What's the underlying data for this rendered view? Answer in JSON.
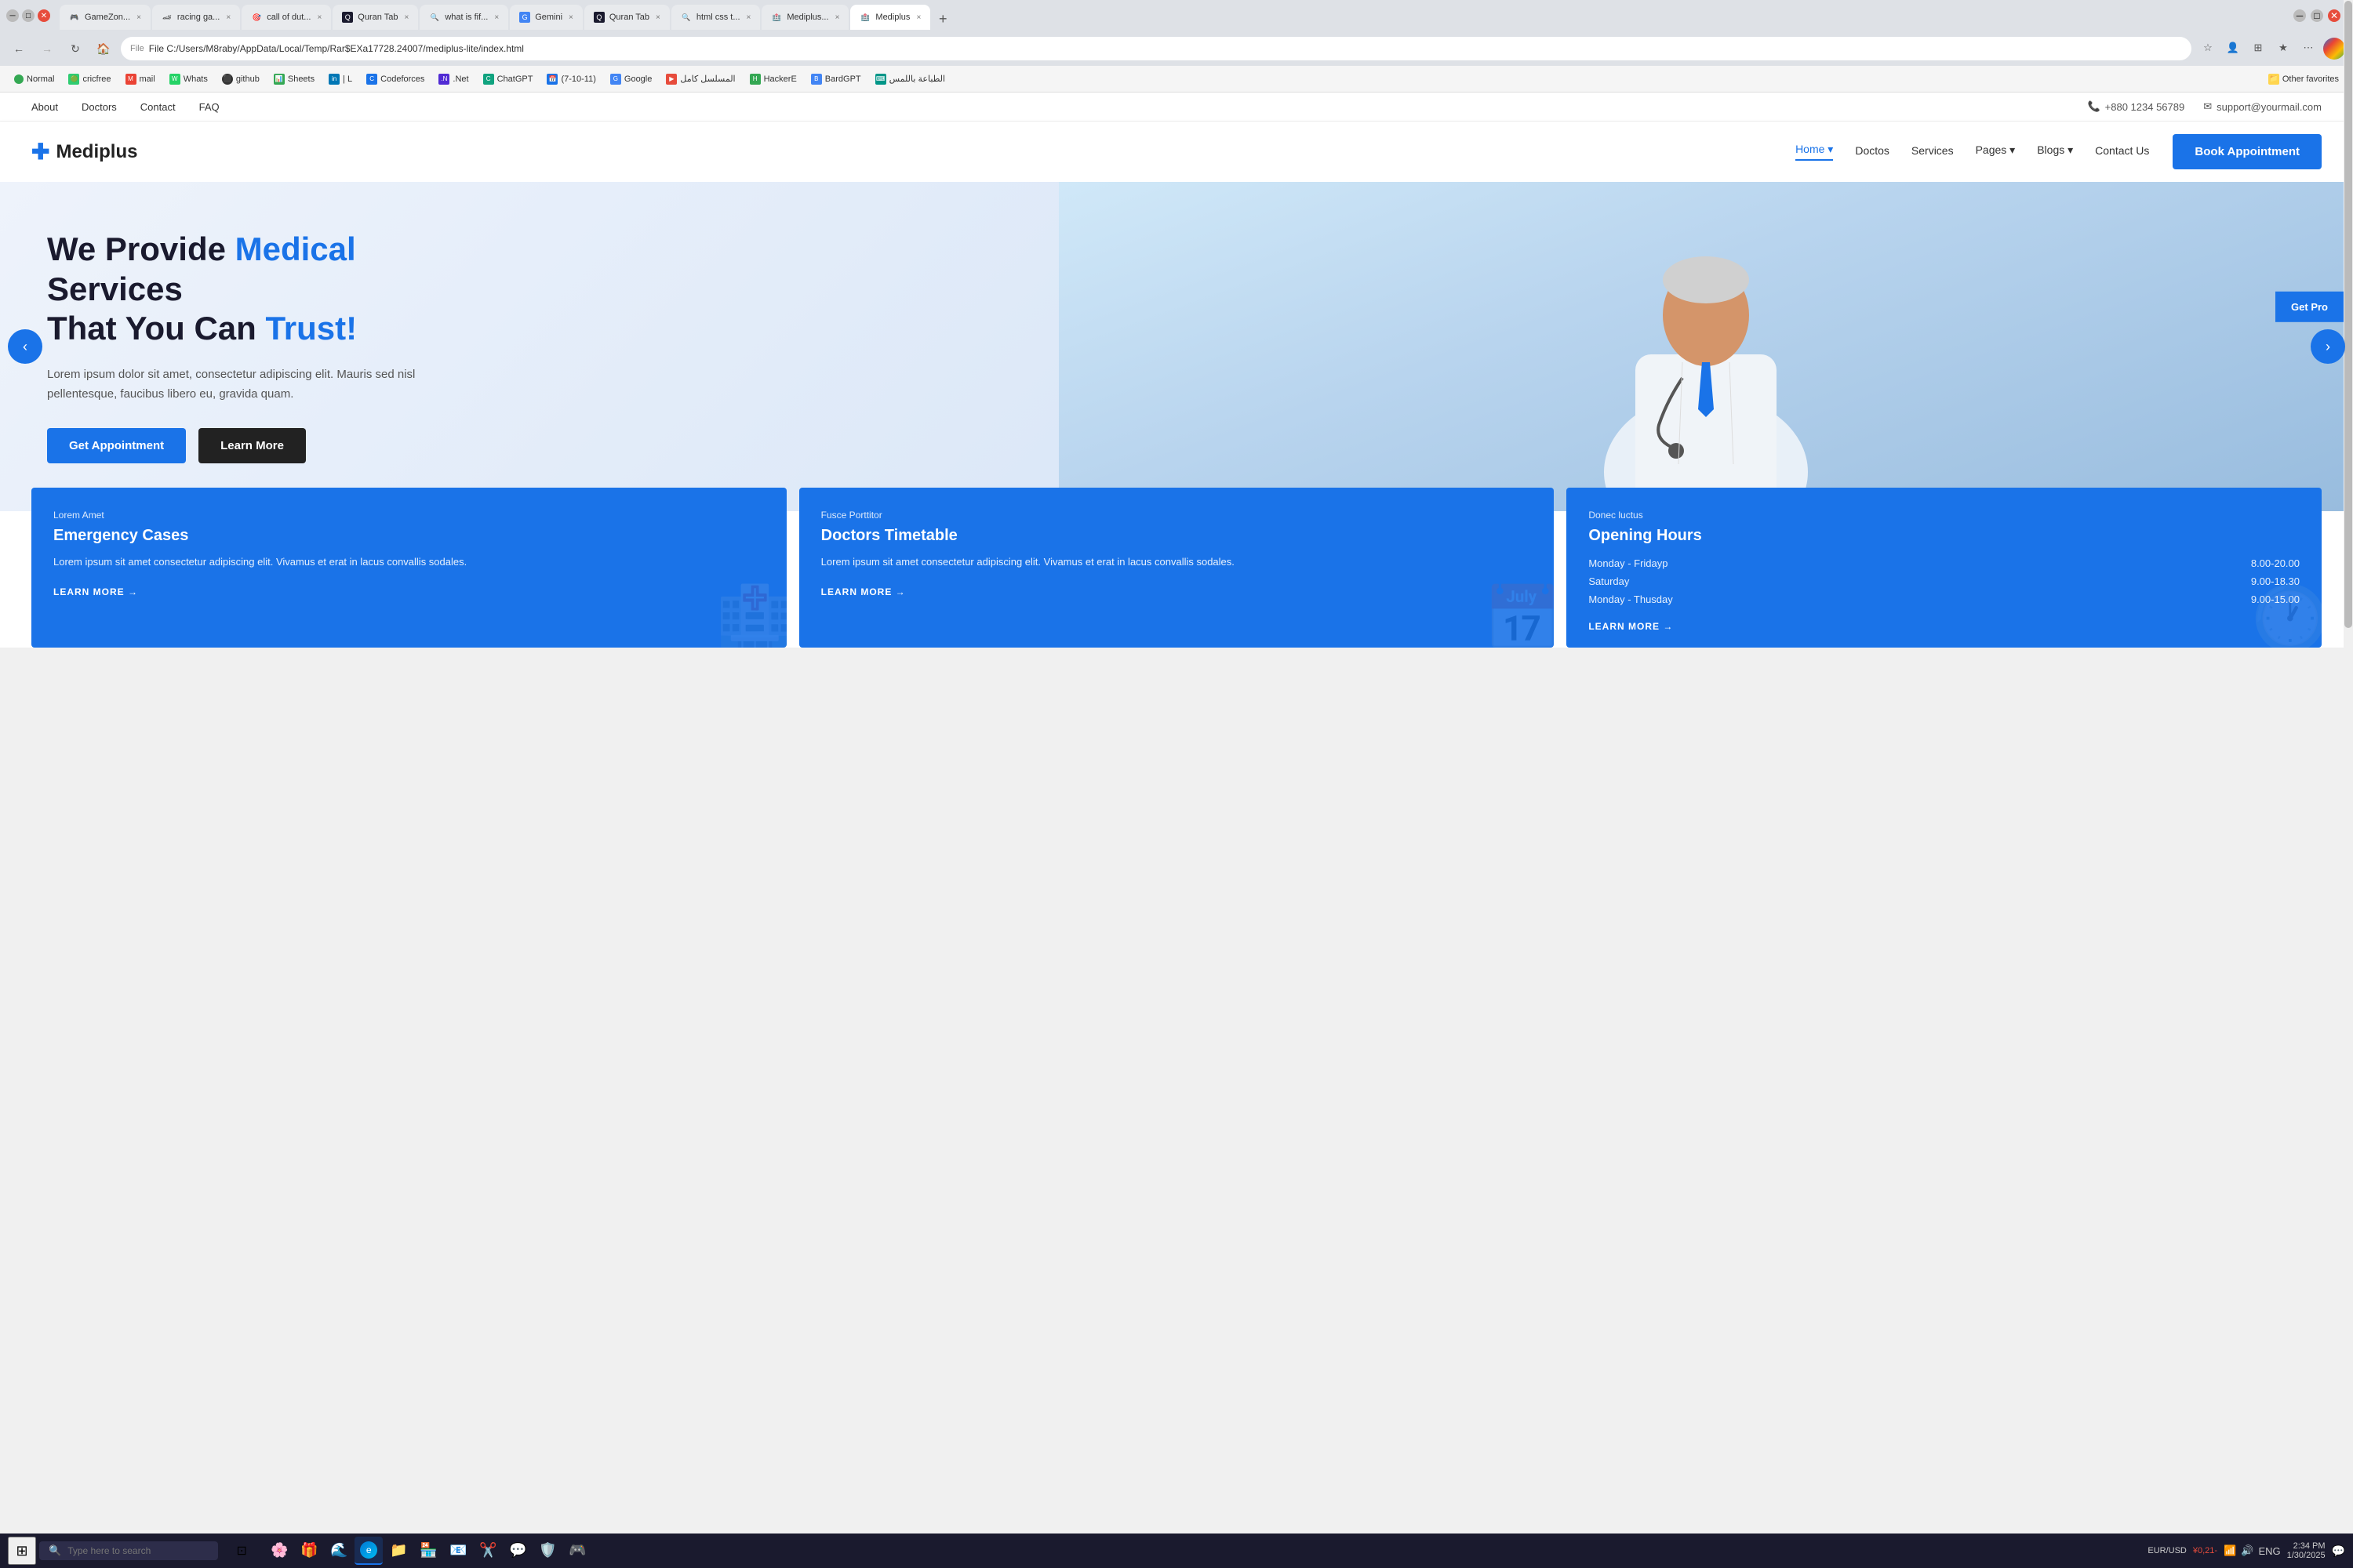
{
  "browser": {
    "tabs": [
      {
        "id": 1,
        "title": "GameZon...",
        "favicon": "🎮",
        "active": false,
        "close": "×"
      },
      {
        "id": 2,
        "title": "racing ga...",
        "favicon": "🏎",
        "active": false,
        "close": "×"
      },
      {
        "id": 3,
        "title": "call of dut...",
        "favicon": "🎯",
        "active": false,
        "close": "×"
      },
      {
        "id": 4,
        "title": "Quran Tab",
        "favicon": "📖",
        "active": false,
        "close": "×"
      },
      {
        "id": 5,
        "title": "what is fif...",
        "favicon": "🔍",
        "active": false,
        "close": "×"
      },
      {
        "id": 6,
        "title": "Gemini",
        "favicon": "✦",
        "active": false,
        "close": "×"
      },
      {
        "id": 7,
        "title": "Quran Tab",
        "favicon": "📖",
        "active": false,
        "close": "×"
      },
      {
        "id": 8,
        "title": "html css t...",
        "favicon": "🔍",
        "active": false,
        "close": "×"
      },
      {
        "id": 9,
        "title": "Mediplus...",
        "favicon": "🏥",
        "active": false,
        "close": "×"
      },
      {
        "id": 10,
        "title": "Mediplus",
        "favicon": "🏥",
        "active": true,
        "close": "×"
      }
    ],
    "address": "File  C:/Users/M8raby/AppData/Local/Temp/Rar$EXa17728.24007/mediplus-lite/index.html",
    "nav_buttons": [
      "←",
      "→",
      "↻",
      "🏠"
    ]
  },
  "bookmarks": [
    {
      "label": "Normal",
      "icon": "🟢",
      "color": "bm-green"
    },
    {
      "label": "cricfree",
      "icon": "🟢",
      "color": "bm-green"
    },
    {
      "label": "mail",
      "icon": "M",
      "color": "bm-mail"
    },
    {
      "label": "Whats",
      "icon": "W",
      "color": "bm-green"
    },
    {
      "label": "github",
      "icon": "⬛",
      "color": "bm-dark"
    },
    {
      "label": "Sheets",
      "icon": "📊",
      "color": "bm-green"
    },
    {
      "label": "| L",
      "icon": "in",
      "color": "bm-blue"
    },
    {
      "label": "Codeforces",
      "icon": "C",
      "color": "bm-blue"
    },
    {
      "label": ".Net",
      "icon": "N",
      "color": "bm-purple"
    },
    {
      "label": "ChatGPT",
      "icon": "⬛",
      "color": "bm-dark"
    },
    {
      "label": "(7-10-11)",
      "icon": "📅",
      "color": "bm-blue"
    },
    {
      "label": "Google",
      "icon": "G",
      "color": "bm-google"
    },
    {
      "label": "المسلسل كامل",
      "icon": "▶",
      "color": "bm-dark"
    },
    {
      "label": "HackerE",
      "icon": "H",
      "color": "bm-green"
    },
    {
      "label": "BardGPT",
      "icon": "B",
      "color": "bm-blue"
    },
    {
      "label": "الطباعة باللمس",
      "icon": "⌨",
      "color": "bm-teal"
    },
    {
      "label": "Other favorites",
      "icon": "📁",
      "color": "bm-folder"
    }
  ],
  "site": {
    "top_nav": [
      {
        "label": "About"
      },
      {
        "label": "Doctors"
      },
      {
        "label": "Contact"
      },
      {
        "label": "FAQ"
      }
    ],
    "contact_phone": "+880 1234 56789",
    "contact_email": "support@yourmail.com",
    "logo_text": "Mediplus",
    "main_nav": [
      {
        "label": "Home",
        "active": true,
        "has_arrow": true
      },
      {
        "label": "Doctos",
        "active": false,
        "has_arrow": false
      },
      {
        "label": "Services",
        "active": false,
        "has_arrow": false
      },
      {
        "label": "Pages",
        "active": false,
        "has_arrow": true
      },
      {
        "label": "Blogs",
        "active": false,
        "has_arrow": true
      },
      {
        "label": "Contact Us",
        "active": false,
        "has_arrow": false
      }
    ],
    "book_btn": "Book Appointment",
    "hero": {
      "title_part1": "We Provide ",
      "title_highlight": "Medical",
      "title_part2": " Services",
      "title_line2": "That You Can ",
      "title_highlight2": "Trust!",
      "description": "Lorem ipsum dolor sit amet, consectetur adipiscing elit. Mauris sed nisl pellentesque, faucibus libero eu, gravida quam.",
      "btn_primary": "Get Appointment",
      "btn_secondary": "Learn More",
      "get_pro": "Get Pro"
    },
    "cards": [
      {
        "label": "Lorem Amet",
        "title": "Emergency Cases",
        "description": "Lorem ipsum sit amet consectetur adipiscing elit. Vivamus et erat in lacus convallis sodales.",
        "link": "LEARN MORE →"
      },
      {
        "label": "Fusce Porttitor",
        "title": "Doctors Timetable",
        "description": "Lorem ipsum sit amet consectetur adipiscing elit. Vivamus et erat in lacus convallis sodales.",
        "link": "LEARN MORE →"
      },
      {
        "label": "Donec luctus",
        "title": "Opening Hours",
        "hours": [
          {
            "day": "Monday - Fridayp",
            "time": "8.00-20.00"
          },
          {
            "day": "Saturday",
            "time": "9.00-18.30"
          },
          {
            "day": "Monday - Thusday",
            "time": "9.00-15.00"
          }
        ],
        "link": "LEARN MORE →"
      }
    ]
  },
  "taskbar": {
    "search_placeholder": "Type here to search",
    "time": "2:34 PM",
    "date": "1/30/2025",
    "currency": "EUR/USD",
    "currency_val": "¥0,21-",
    "lang": "ENG"
  }
}
